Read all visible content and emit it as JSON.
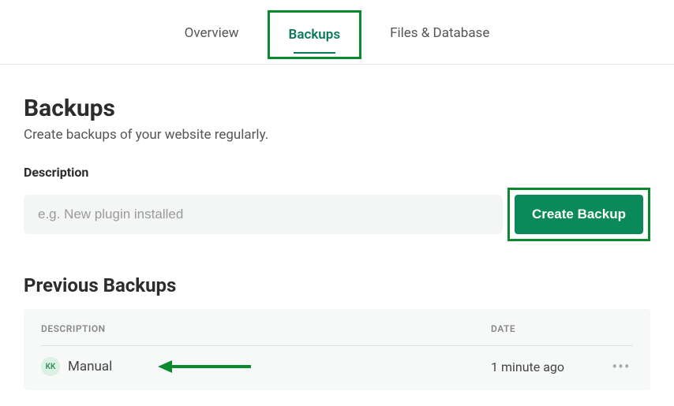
{
  "tabs": {
    "overview": "Overview",
    "backups": "Backups",
    "files_db": "Files & Database"
  },
  "page": {
    "title": "Backups",
    "subtitle": "Create backups of your website regularly.",
    "field_label": "Description",
    "input_placeholder": "e.g. New plugin installed",
    "create_button": "Create Backup"
  },
  "previous": {
    "heading": "Previous Backups",
    "col_description": "DESCRIPTION",
    "col_date": "DATE",
    "rows": [
      {
        "avatar": "KK",
        "description": "Manual",
        "date": "1 minute ago"
      }
    ]
  },
  "annotation": {
    "highlight_color": "#0a8a2f"
  }
}
